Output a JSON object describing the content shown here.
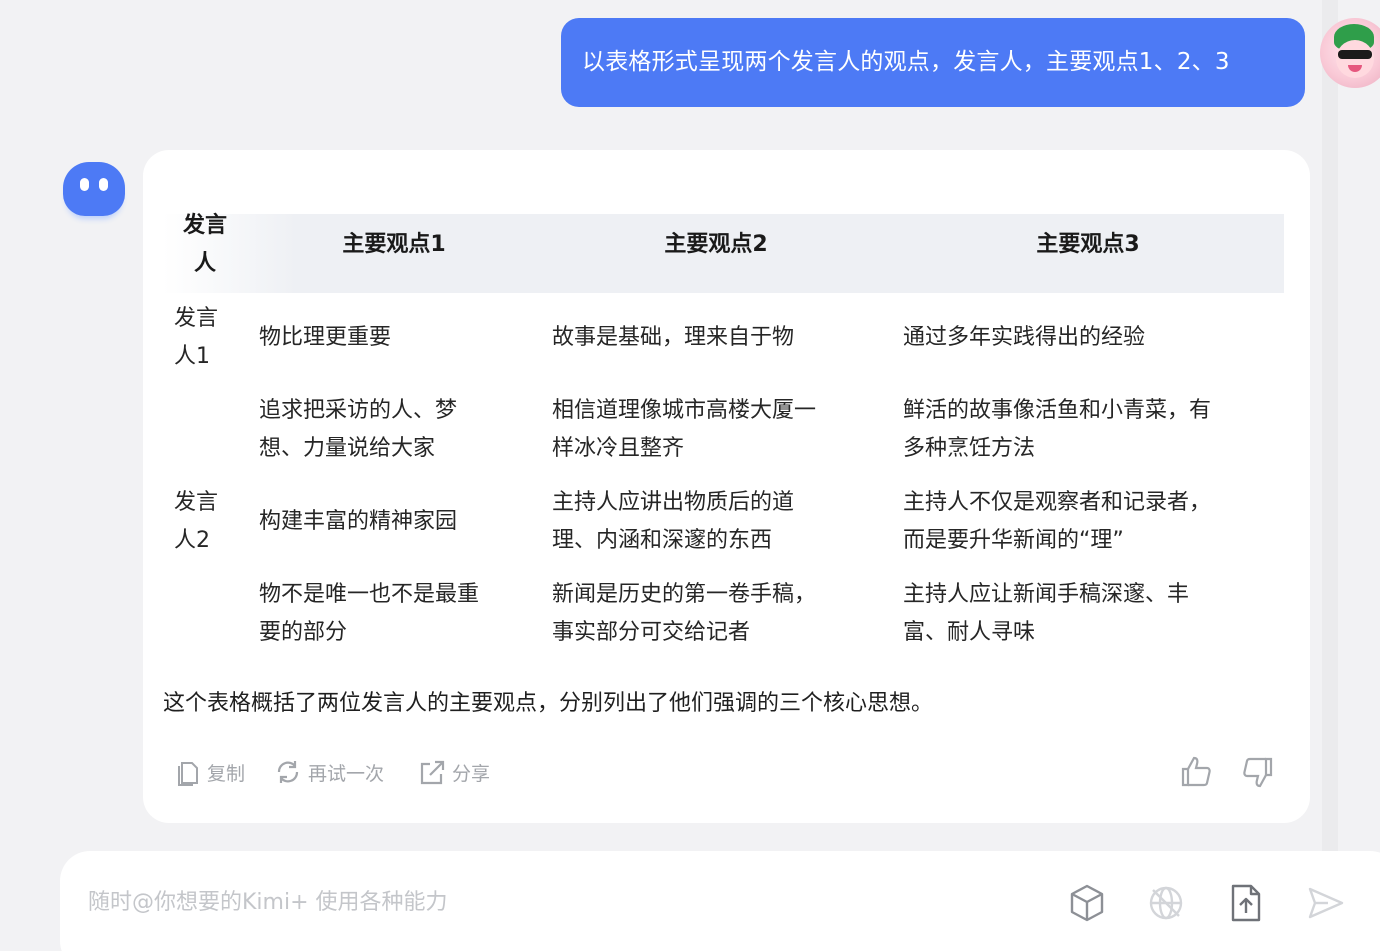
{
  "user_message": {
    "text": "以表格形式呈现两个发言人的观点，发言人，主要观点1、2、3"
  },
  "answer": {
    "table": {
      "headers": [
        "发言\n人",
        "主要观点1",
        "主要观点2",
        "主要观点3"
      ],
      "rows": [
        {
          "speaker": "发言\n人1",
          "p1": "物比理更重要",
          "p2": "故事是基础，理来自于物",
          "p3": "通过多年实践得出的经验"
        },
        {
          "speaker": "",
          "p1": "追求把采访的人、梦\n想、力量说给大家",
          "p2": "相信道理像城市高楼大厦一\n样冰冷且整齐",
          "p3": "鲜活的故事像活鱼和小青菜，有\n多种烹饪方法"
        },
        {
          "speaker": "发言\n人2",
          "p1": "构建丰富的精神家园",
          "p2": "主持人应讲出物质后的道\n理、内涵和深邃的东西",
          "p3": "主持人不仅是观察者和记录者，\n而是要升华新闻的“理”"
        },
        {
          "speaker": "",
          "p1": "物不是唯一也不是最重\n要的部分",
          "p2": "新闻是历史的第一卷手稿，\n事实部分可交给记者",
          "p3": "主持人应让新闻手稿深邃、丰\n富、耐人寻味"
        }
      ]
    },
    "summary": "这个表格概括了两位发言人的主要观点，分别列出了他们强调的三个核心思想。",
    "actions": {
      "copy": "复制",
      "retry": "再试一次",
      "share": "分享"
    }
  },
  "input": {
    "placeholder": "随时@你想要的Kimi+ 使用各种能力"
  },
  "colors": {
    "accent": "#4d7af5",
    "page_bg": "#f2f2f4",
    "header_bg": "#eef0f4"
  },
  "icons": [
    "copy-icon",
    "refresh-icon",
    "share-icon",
    "thumbs-up-icon",
    "thumbs-down-icon",
    "cube-icon",
    "web-search-off-icon",
    "upload-file-icon",
    "send-icon"
  ]
}
